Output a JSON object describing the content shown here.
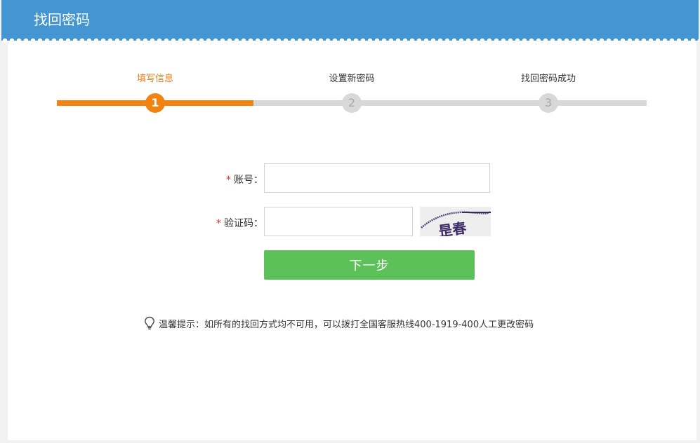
{
  "header": {
    "title": "找回密码"
  },
  "steps": [
    {
      "label": "填写信息",
      "number": "1",
      "active": true
    },
    {
      "label": "设置新密码",
      "number": "2",
      "active": false
    },
    {
      "label": "找回密码成功",
      "number": "3",
      "active": false
    }
  ],
  "progress": {
    "completed_fraction": 0.333
  },
  "form": {
    "account": {
      "required_mark": "*",
      "label": "账号：",
      "value": "",
      "placeholder": ""
    },
    "captcha": {
      "required_mark": "*",
      "label": "验证码：",
      "value": "",
      "placeholder": "",
      "image_text": "昰春"
    },
    "next_button": "下一步"
  },
  "tip": {
    "text": "温馨提示：如所有的找回方式均不可用，可以拨打全国客服热线400-1919-400人工更改密码"
  },
  "colors": {
    "header_bg": "#4396d2",
    "active_step": "#f28311",
    "inactive_step": "#d8d8d8",
    "button_bg": "#5dc15a",
    "required": "#e03030"
  }
}
